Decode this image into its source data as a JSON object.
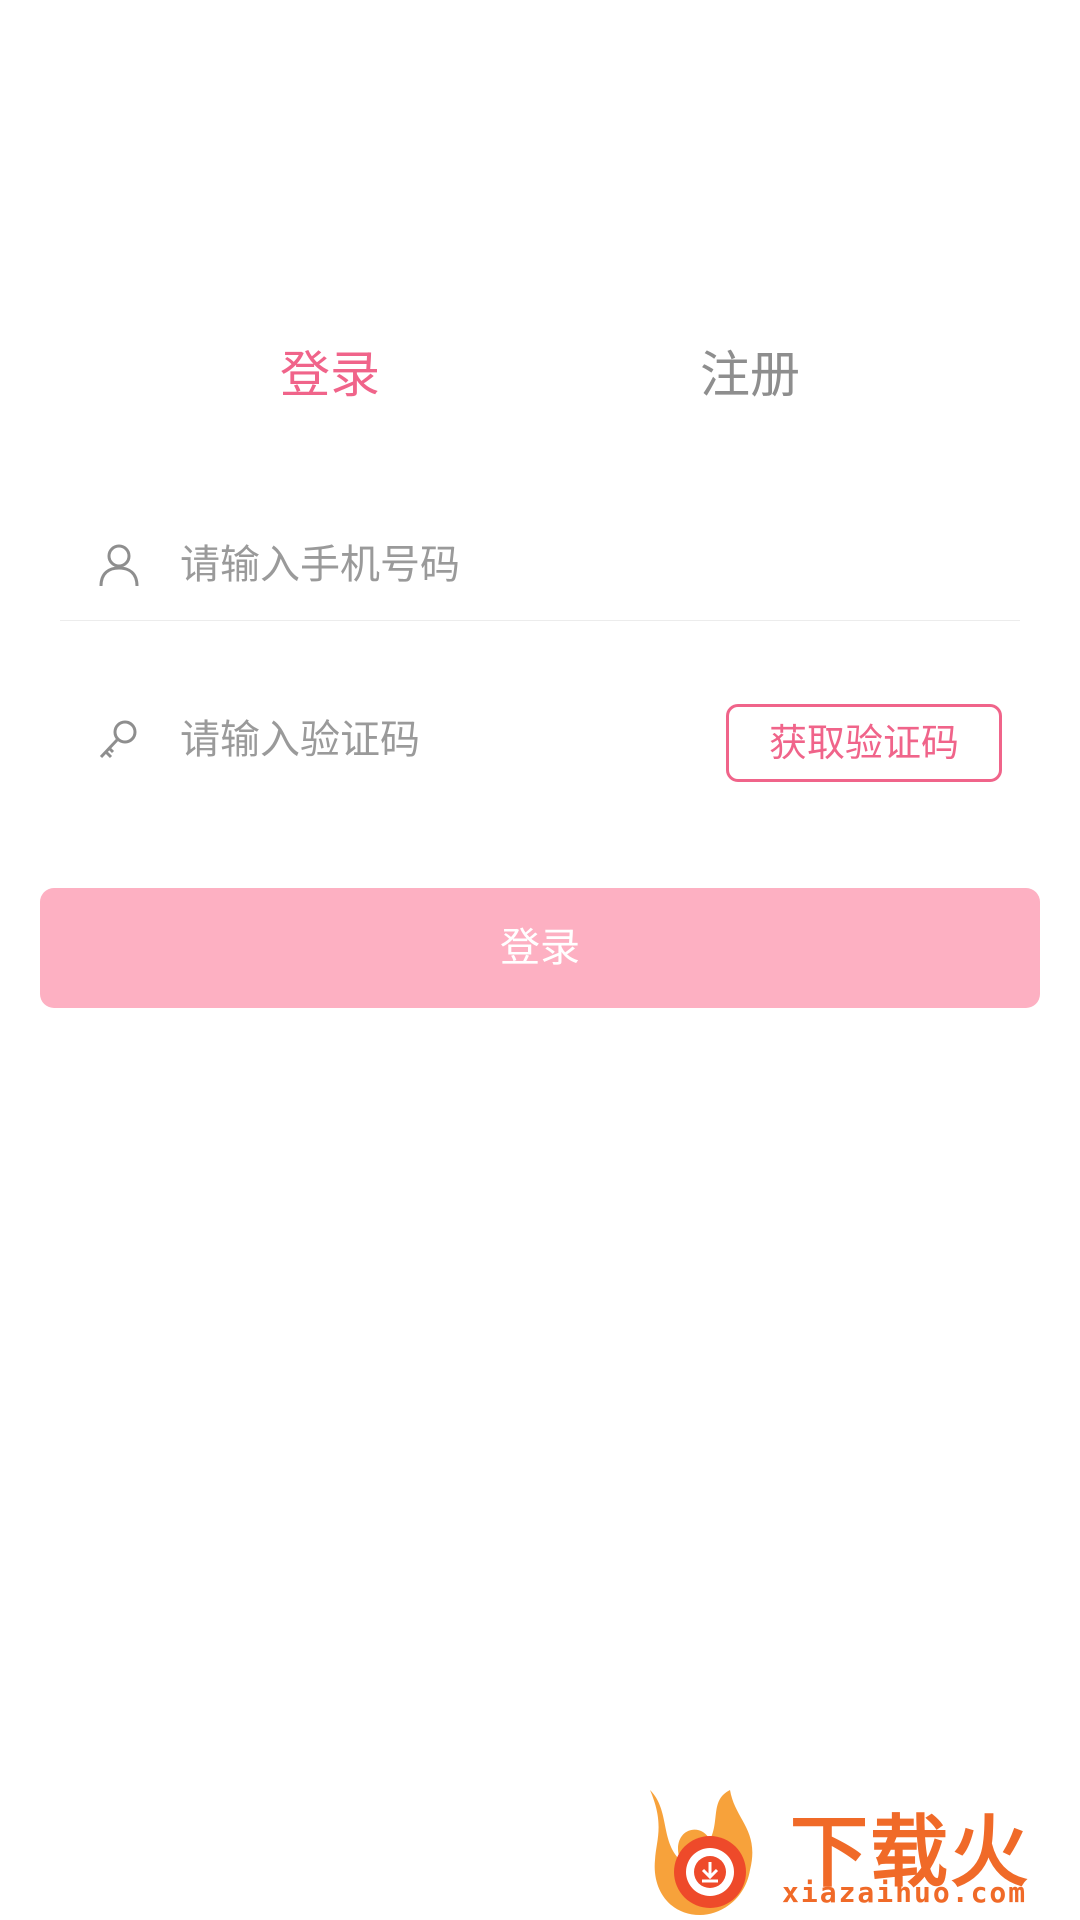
{
  "tabs": {
    "login": "登录",
    "register": "注册",
    "active": "login"
  },
  "form": {
    "phone": {
      "placeholder": "请输入手机号码",
      "value": "",
      "icon": "user-icon"
    },
    "code": {
      "placeholder": "请输入验证码",
      "value": "",
      "icon": "key-icon",
      "get_code_label": "获取验证码"
    },
    "submit_label": "登录"
  },
  "watermark": {
    "logo": "下载火",
    "url": "xiazaihuo.com"
  },
  "colors": {
    "accent": "#f0648a",
    "button_bg": "#fdb0c2",
    "inactive_text": "#8e8e8e",
    "placeholder": "#9a9a9a",
    "watermark": "#f06a28"
  }
}
